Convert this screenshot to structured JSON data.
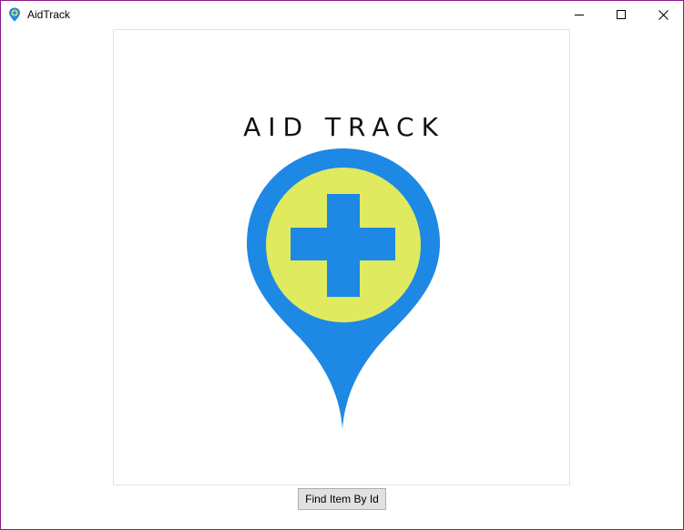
{
  "window": {
    "title": "AidTrack",
    "app_icon": "map-pin-plus-icon",
    "controls": {
      "minimize_icon": "minimize-icon",
      "maximize_icon": "maximize-icon",
      "close_icon": "close-icon"
    },
    "border_color": "#8b1a8b"
  },
  "logo": {
    "title": "AID TRACK",
    "pin_icon": "map-pin-plus-icon",
    "colors": {
      "pin": "#1e88e5",
      "circle": "#e0ea5f",
      "cross": "#1e88e5",
      "text": "#111111"
    }
  },
  "actions": {
    "find_item_label": "Find Item By Id"
  }
}
